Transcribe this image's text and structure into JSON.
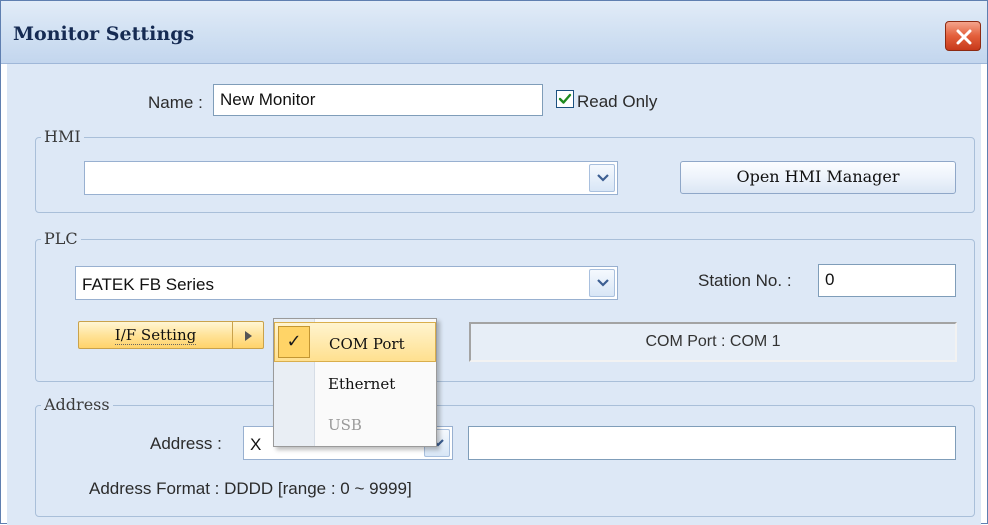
{
  "window": {
    "title": "Monitor Settings"
  },
  "name_row": {
    "label": "Name :",
    "value": "New Monitor",
    "read_only_label": "Read Only",
    "read_only_checked": true
  },
  "hmi": {
    "legend": "HMI",
    "selected": "",
    "open_manager_label": "Open HMI Manager"
  },
  "plc": {
    "legend": "PLC",
    "selected": "FATEK FB Series",
    "station_label": "Station No. :",
    "station_value": "0",
    "if_setting_label": "I/F Setting",
    "status_text": "COM Port : COM 1"
  },
  "if_menu": {
    "items": [
      {
        "label": "COM Port",
        "checked": true,
        "enabled": true
      },
      {
        "label": "Ethernet",
        "checked": false,
        "enabled": true
      },
      {
        "label": "USB",
        "checked": false,
        "enabled": false
      }
    ],
    "check_glyph": "✓"
  },
  "address": {
    "legend": "Address",
    "label": "Address :",
    "device_value": "X",
    "address_value": "",
    "format_text": "Address Format :  DDDD [range : 0 ~ 9999]"
  },
  "colors": {
    "titlebar": "#d3e2f3",
    "dialog_bg": "#dde8f6",
    "close": "#e35f3b",
    "menu_highlight": "#ffe08f",
    "button_hover": "#ffd36a"
  },
  "icons": {
    "close": "close-icon",
    "dropdown": "chevron-down-icon",
    "submenu": "triangle-right-icon",
    "check": "checkmark-icon"
  }
}
